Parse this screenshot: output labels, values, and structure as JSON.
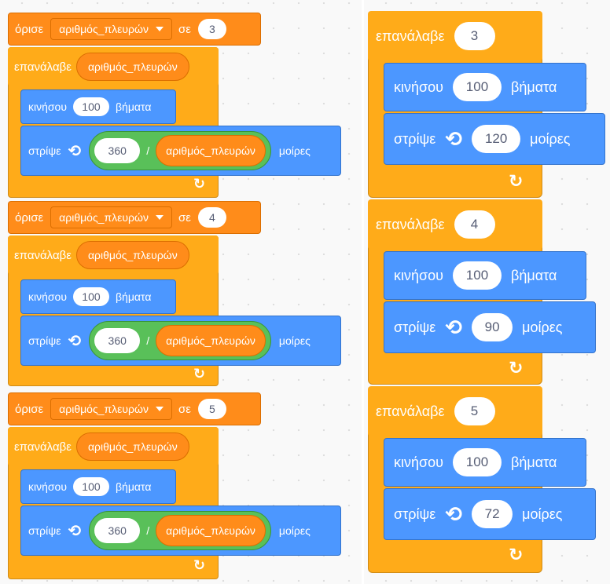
{
  "blocks": {
    "set_label": "όρισε",
    "to_label": "σε",
    "repeat_label": "επανάλαβε",
    "move_label": "κινήσου",
    "steps_label": "βήματα",
    "turn_label": "στρίψε",
    "degrees_label": "μοίρες",
    "div_label": "/"
  },
  "variable": {
    "name": "αριθμός_πλευρών"
  },
  "colors": {
    "events_orange": "#ff8c1a",
    "control_yellow": "#ffab19",
    "motion_blue": "#4c97ff",
    "operators_green": "#59c059"
  },
  "icons": {
    "turn": "turn-left-arrow-icon",
    "loop_end": "loop-arrow-icon",
    "dropdown": "dropdown-triangle-icon"
  },
  "left_script": [
    {
      "set_value": "3",
      "move_steps": "100",
      "dividend": "360"
    },
    {
      "set_value": "4",
      "move_steps": "100",
      "dividend": "360"
    },
    {
      "set_value": "5",
      "move_steps": "100",
      "dividend": "360"
    }
  ],
  "right_script": [
    {
      "repeat_times": "3",
      "move_steps": "100",
      "turn_degrees": "120"
    },
    {
      "repeat_times": "4",
      "move_steps": "100",
      "turn_degrees": "90"
    },
    {
      "repeat_times": "5",
      "move_steps": "100",
      "turn_degrees": "72"
    }
  ]
}
